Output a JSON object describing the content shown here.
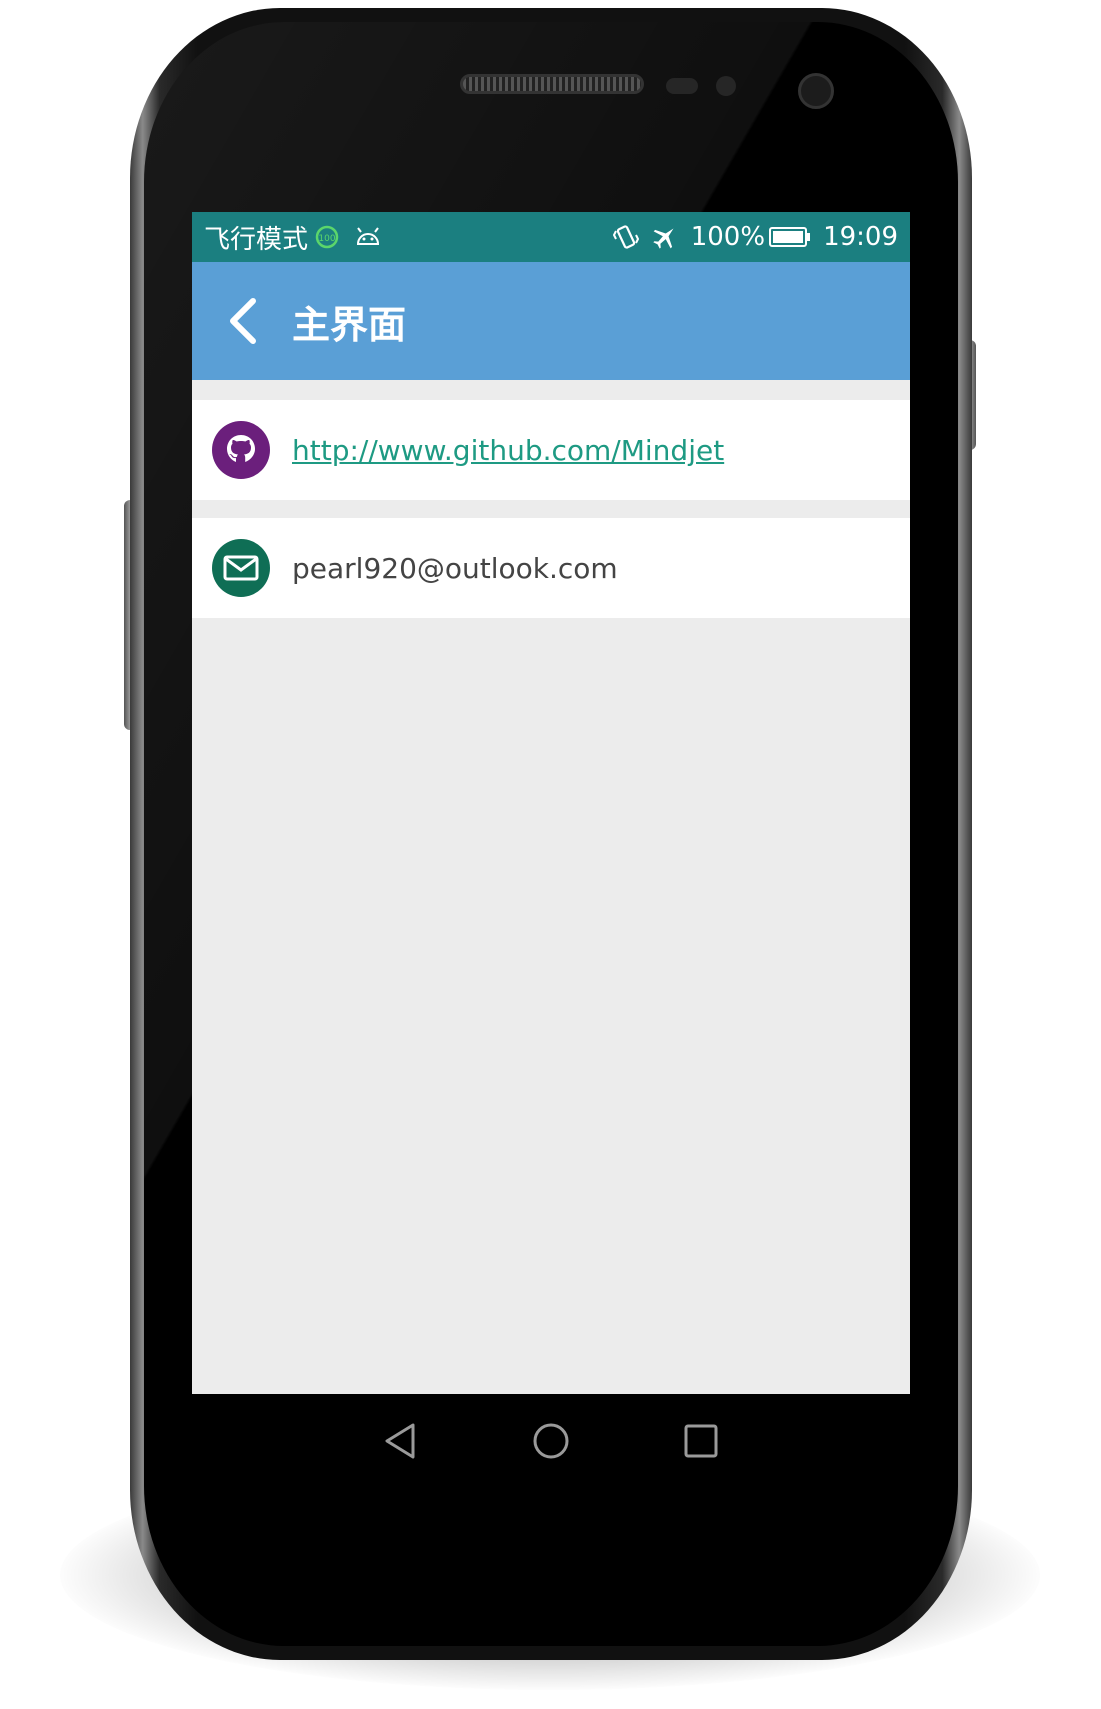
{
  "status_bar": {
    "left_text": "飞行模式",
    "badge_value": "100",
    "battery_percent": "100%",
    "time": "19:09",
    "icons": [
      "data-saver-100-icon",
      "android-icon",
      "vibrate-icon",
      "airplane-icon",
      "battery-icon"
    ],
    "background_color": "#1b7f80"
  },
  "app_bar": {
    "title": "主界面",
    "back_icon": "chevron-left-icon",
    "background_color": "#5a9fd6"
  },
  "items": [
    {
      "icon": "github-icon",
      "icon_color": "#6b1f7c",
      "text": "http://www.github.com/Mindjet",
      "type": "link"
    },
    {
      "icon": "mail-icon",
      "icon_color": "#0f6e55",
      "text": "pearl920@outlook.com",
      "type": "text"
    }
  ],
  "nav_bar": {
    "buttons": [
      "back-triangle-icon",
      "home-circle-icon",
      "recents-square-icon"
    ]
  }
}
